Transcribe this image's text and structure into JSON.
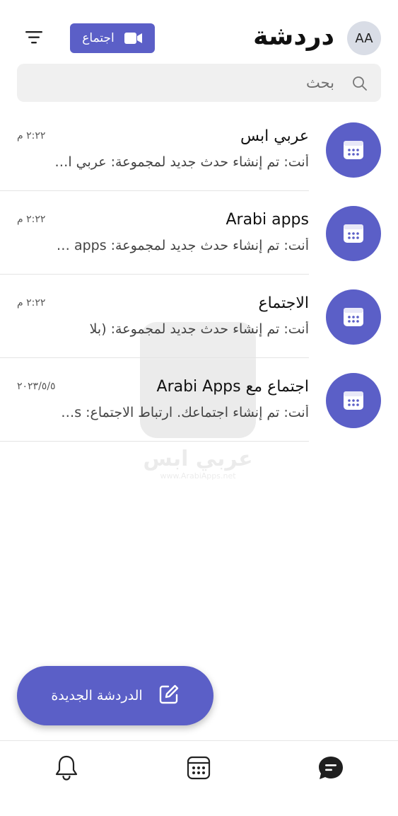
{
  "header": {
    "avatar_initials": "AA",
    "title": "دردشة",
    "meet_button_label": "اجتماع",
    "icons": {
      "filter": "filter-icon",
      "video": "video-camera-icon"
    }
  },
  "search": {
    "placeholder": "بحث",
    "icon": "search-icon"
  },
  "chats": [
    {
      "name": "عربي ابس",
      "time": "٢:٢٢ م",
      "preview": "أنت: تم إنشاء حدث جديد لمجموعة: عربي ابس",
      "icon": "calendar-icon"
    },
    {
      "name": "Arabi apps",
      "time": "٢:٢٢ م",
      "preview": "أنت: تم إنشاء حدث جديد لمجموعة: Arabi apps",
      "icon": "calendar-icon"
    },
    {
      "name": "الاجتماع",
      "time": "٢:٢٢ م",
      "preview": "أنت: تم إنشاء حدث جديد لمجموعة: (بلا",
      "icon": "calendar-icon"
    },
    {
      "name": "اجتماع مع Arabi Apps",
      "time": "٢٠٢٣/٥/٥",
      "preview": "أنت: تم إنشاء اجتماعك. ارتباط الاجتماع: https",
      "icon": "calendar-icon"
    }
  ],
  "watermark": {
    "text": "عربي ابس",
    "sub": "www.ArabiApps.net"
  },
  "fab": {
    "label": "الدردشة الجديدة",
    "icon": "compose-icon"
  },
  "bottom_nav": [
    {
      "name": "activity",
      "icon": "bell-icon"
    },
    {
      "name": "calendar",
      "icon": "calendar-icon"
    },
    {
      "name": "chat",
      "icon": "chat-icon"
    }
  ],
  "colors": {
    "accent": "#5b5fc7",
    "avatar_bg": "#d9dde6",
    "search_bg": "#f0f0f0"
  }
}
